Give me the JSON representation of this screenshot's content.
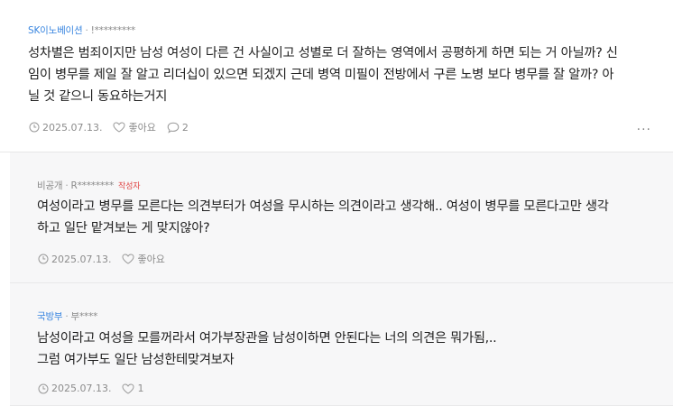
{
  "post": {
    "company": "SK이노베이션",
    "author": "!*********",
    "lines": [
      "성차별은 범죄이지만 남성 여성이 다른 건 사실이고 성별로 더 잘하는 영역에서 공평하게 하면 되는 거 아닐까? 신",
      "임이 병무를 제일 잘 알고 리더십이 있으면 되겠지 근데 병역 미필이 전방에서 구른 노병 보다 병무를 잘 알까? 아",
      "닐 것 같으니 동요하는거지"
    ],
    "date": "2025.07.13.",
    "like_label": "좋아요",
    "comment_count": "2",
    "more_label": "..."
  },
  "replies": [
    {
      "company": "비공개",
      "author": "R********",
      "badge": "작성자",
      "lines": [
        "여성이라고 병무를 모른다는 의견부터가 여성을 무시하는 의견이라고 생각해.. 여성이 병무를 모른다고만 생각",
        "하고 일단 맡겨보는 게 맞지않아?"
      ],
      "date": "2025.07.13.",
      "like_label": "좋아요"
    },
    {
      "company": "국방부",
      "author": "부****",
      "lines": [
        "남성이라고 여성을 모를꺼라서 여가부장관을 남성이하면 안된다는 너의 의견은 뭐가됨,..",
        "그럼 여가부도 일단 남성한테맞겨보자"
      ],
      "date": "2025.07.13.",
      "like_label": "1"
    }
  ]
}
